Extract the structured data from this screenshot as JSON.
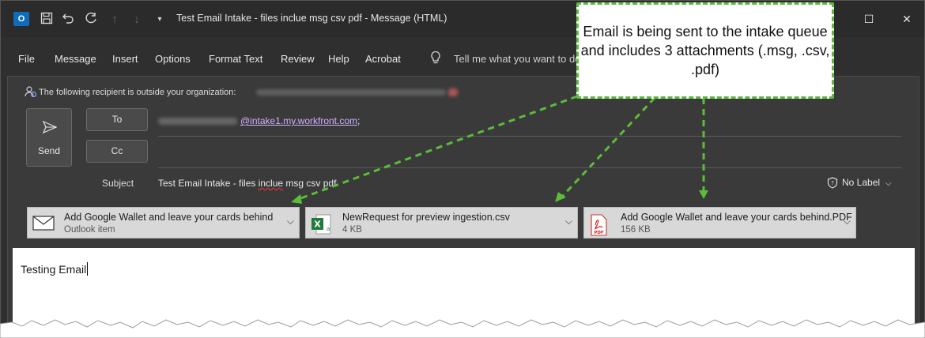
{
  "window": {
    "title": "Test Email Intake - files inclue msg csv pdf  -  Message (HTML)",
    "controls": {
      "minimize": "—",
      "maximize": "☐",
      "close": "✕"
    }
  },
  "menu": {
    "items": [
      "File",
      "Message",
      "Insert",
      "Options",
      "Format Text",
      "Review",
      "Help",
      "Acrobat"
    ],
    "tell_me_placeholder": "Tell me what you want to do"
  },
  "recipient_warning": "The following recipient is outside your organization:",
  "send": {
    "label": "Send"
  },
  "fields": {
    "to_label": "To",
    "cc_label": "Cc",
    "to_address_domain": "@intake1.my.workfront.com",
    "to_address_separator": ";",
    "subject_label": "Subject",
    "subject_prefix": "Test Email Intake - files ",
    "subject_misspelled": "inclue",
    "subject_suffix": " msg csv pdf"
  },
  "sensitivity": {
    "label": "No Label"
  },
  "attachments": [
    {
      "name": "Add Google Wallet and leave your cards behind",
      "detail": "Outlook item",
      "icon": "envelope-icon"
    },
    {
      "name": "NewRequest for preview ingestion.csv",
      "detail": "4 KB",
      "icon": "excel-icon"
    },
    {
      "name": "Add Google Wallet and leave your cards behind.PDF",
      "detail": "156 KB",
      "icon": "pdf-icon"
    }
  ],
  "body": {
    "text": "Testing Email"
  },
  "callout": {
    "text": "Email is being sent to the intake queue and includes 3 attachments (.msg, .csv, .pdf)",
    "border_color": "#5bbd3a"
  }
}
